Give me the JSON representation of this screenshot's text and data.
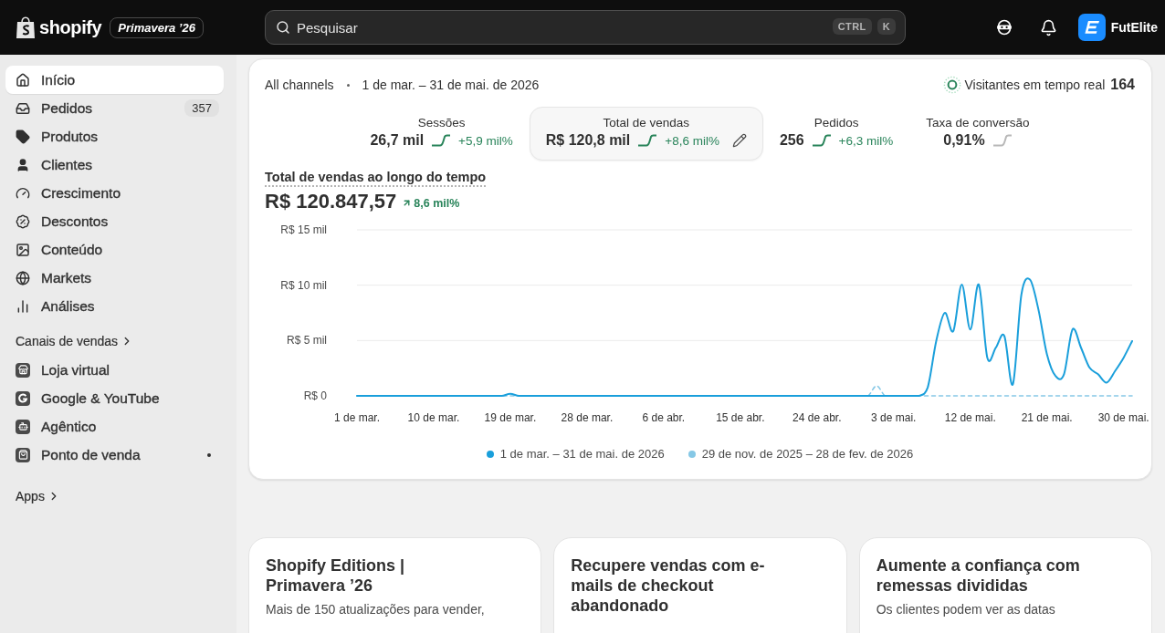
{
  "top_bar": {
    "brand": "shopify",
    "badge": "Primavera ’26",
    "search": {
      "placeholder": "Pesquisar",
      "shortcut": [
        "CTRL",
        "K"
      ]
    },
    "store_name": "FutElite"
  },
  "sidebar": {
    "items": [
      {
        "label": "Início",
        "selected": true
      },
      {
        "label": "Pedidos",
        "selected": false,
        "badge": "357"
      },
      {
        "label": "Produtos",
        "selected": false
      },
      {
        "label": "Clientes",
        "selected": false
      },
      {
        "label": "Crescimento",
        "selected": false
      },
      {
        "label": "Descontos",
        "selected": false
      },
      {
        "label": "Conteúdo",
        "selected": false
      },
      {
        "label": "Markets",
        "selected": false
      },
      {
        "label": "Análises",
        "selected": false
      }
    ],
    "sales_channels": {
      "label": "Canais de vendas",
      "items": [
        {
          "label": "Loja virtual",
          "notification": false
        },
        {
          "label": "Google & YouTube",
          "notification": false
        },
        {
          "label": "Agêntico",
          "notification": false
        },
        {
          "label": "Ponto de venda",
          "notification": true
        }
      ]
    },
    "apps": {
      "label": "Apps"
    }
  },
  "overview": {
    "channel": "All channels",
    "date_range": "1 de mar. – 31 de mai. de 2026",
    "live_visitors": {
      "label": "Visitantes em tempo real",
      "count": "164"
    },
    "metrics": [
      {
        "label": "Sessões",
        "value": "26,7 mil",
        "change": "+5,9 mil%",
        "trend_up": true,
        "selected": false
      },
      {
        "label": "Total de vendas",
        "value": "R$ 120,8 mil",
        "change": "+8,6 mil%",
        "trend_up": true,
        "selected": true
      },
      {
        "label": "Pedidos",
        "value": "256",
        "change": "+6,3 mil%",
        "trend_up": true,
        "selected": false
      },
      {
        "label": "Taxa de conversão",
        "value": "0,91%",
        "trend_up": false,
        "selected": false
      }
    ],
    "sales_over_time": {
      "title": "Total de vendas ao longo do tempo",
      "total": "R$ 120.847,57",
      "change": "8,6 mil%",
      "y_axis_labels": [
        "R$ 15 mil",
        "R$ 10 mil",
        "R$ 5 mil",
        "R$ 0"
      ],
      "x_axis_labels": [
        "1 de mar.",
        "10 de mar.",
        "19 de mar.",
        "28 de mar.",
        "6 de abr.",
        "15 de abr.",
        "24 de abr.",
        "3 de mai.",
        "12 de mai.",
        "21 de mai.",
        "30 de mai."
      ],
      "legend": [
        {
          "label": "1 de mar. – 31 de mai. de 2026",
          "color": "#1a9fdb",
          "dashed": false
        },
        {
          "label": "29 de nov. de 2025 – 28 de fev. de 2026",
          "color": "#86c8e6",
          "dashed": true
        }
      ]
    }
  },
  "cards": [
    {
      "title": "Shopify Editions | Primavera ’26",
      "description": "Mais de 150 atualizações para vender,"
    },
    {
      "title": "Recupere vendas com e-mails de checkout abandonado"
    },
    {
      "title": "Aumente a confiança com remessas divididas",
      "description": "Os clientes podem ver as datas"
    }
  ]
}
